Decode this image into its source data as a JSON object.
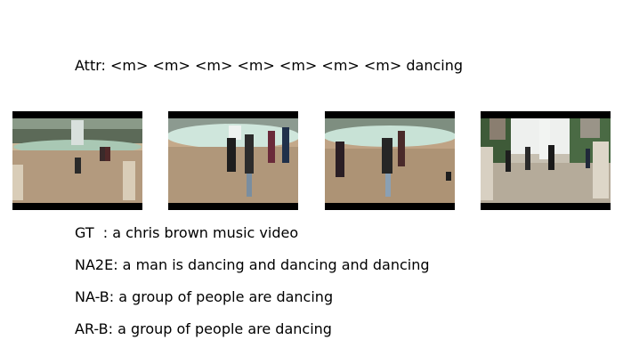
{
  "attr_line": "Attr: <m> <m> <m> <m> <m> <m> <m> dancing",
  "frames": [
    {
      "label": "video-frame-1"
    },
    {
      "label": "video-frame-2"
    },
    {
      "label": "video-frame-3"
    },
    {
      "label": "video-frame-4"
    }
  ],
  "captions": {
    "gt": "GT  : a chris brown music video",
    "na2e": "NA2E: a man is dancing and dancing and dancing",
    "na_b": "NA-B: a group of people are dancing",
    "ar_b": "AR-B: a group of people are dancing"
  }
}
